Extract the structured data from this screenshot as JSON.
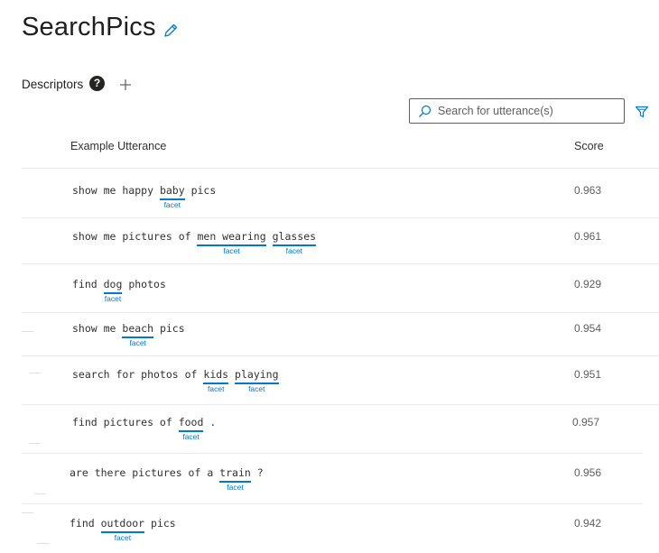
{
  "app": {
    "title": "SearchPics"
  },
  "descriptors": {
    "label": "Descriptors",
    "help_glyph": "?"
  },
  "search": {
    "placeholder": "Search for utterance(s)"
  },
  "table": {
    "col_utterance": "Example Utterance",
    "col_score": "Score",
    "rows": [
      {
        "parts": [
          "show me happy ",
          {
            "t": "baby"
          },
          " pics"
        ],
        "entity": "facet",
        "score": "0.963"
      },
      {
        "parts": [
          "show me pictures of ",
          {
            "t": "men wearing"
          },
          " ",
          {
            "t": "glasses"
          }
        ],
        "entity": "facet",
        "score": "0.961"
      },
      {
        "parts": [
          "find ",
          {
            "t": "dog"
          },
          " photos"
        ],
        "entity": "facet",
        "score": "0.929"
      },
      {
        "parts": [
          "show me ",
          {
            "t": "beach"
          },
          " pics"
        ],
        "entity": "facet",
        "score": "0.954"
      },
      {
        "parts": [
          "search for photos of ",
          {
            "t": "kids"
          },
          " ",
          {
            "t": "playing"
          }
        ],
        "entity": "facet",
        "score": "0.951"
      },
      {
        "parts": [
          "find pictures of ",
          {
            "t": "food"
          },
          " ."
        ],
        "entity": "facet",
        "score": "0.957"
      },
      {
        "parts": [
          "are there pictures of a ",
          {
            "t": "train"
          },
          " ?"
        ],
        "entity": "facet",
        "score": "0.956"
      },
      {
        "parts": [
          "find ",
          {
            "t": "outdoor"
          },
          " pics"
        ],
        "entity": "facet",
        "score": "0.942"
      }
    ]
  },
  "colors": {
    "accent": "#0078d4",
    "text": "#323130",
    "muted": "#605e5c"
  },
  "icons": {
    "edit": "pencil-icon",
    "help": "help-icon",
    "add": "plus-icon",
    "search": "search-icon",
    "filter": "filter-icon"
  }
}
